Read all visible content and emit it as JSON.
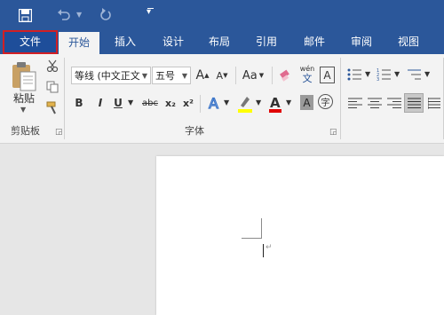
{
  "quick_access": {
    "save_icon": "save-icon",
    "undo_icon": "undo-icon",
    "redo_icon": "redo-icon",
    "customize_icon": "customize-qat-icon"
  },
  "tabs": [
    {
      "label": "文件",
      "state": "file-highlighted"
    },
    {
      "label": "开始",
      "state": "active"
    },
    {
      "label": "插入"
    },
    {
      "label": "设计"
    },
    {
      "label": "布局"
    },
    {
      "label": "引用"
    },
    {
      "label": "邮件"
    },
    {
      "label": "审阅"
    },
    {
      "label": "视图"
    }
  ],
  "clipboard": {
    "paste_label": "粘贴",
    "group_label": "剪贴板"
  },
  "font": {
    "font_name": "等线 (中文正文",
    "font_size": "五号",
    "group_label": "字体",
    "aa_label": "Aa",
    "pinyin_label": "wén",
    "pinyin_char": "文",
    "border_char": "A",
    "bold": "B",
    "italic": "I",
    "underline": "U",
    "strike": "abc",
    "subscript": "x₂",
    "superscript": "x²",
    "char_shading": "A",
    "enclose_char": "字"
  },
  "colors": {
    "brand": "#2b579a",
    "file_tab_highlight": "#d21f24",
    "font_color": "#e00000",
    "highlight_color": "#ffff00"
  }
}
